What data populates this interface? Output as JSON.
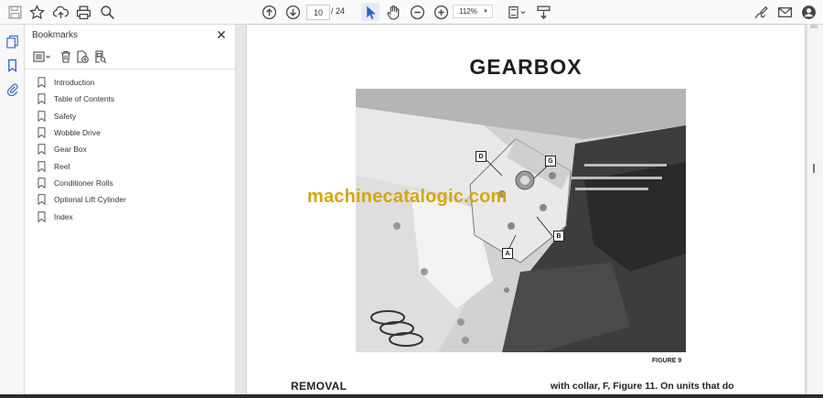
{
  "toolbar": {
    "page_current": "10",
    "page_separator": "/",
    "page_total": "24",
    "zoom": "112%",
    "icons": [
      "save-icon",
      "star-icon",
      "upload-cloud-icon",
      "print-icon",
      "zoom-search-icon",
      "prev-page-icon",
      "next-page-icon",
      "select-cursor-icon",
      "hand-icon",
      "zoom-out-icon",
      "zoom-in-icon",
      "fit-page-icon",
      "scroll-mode-icon",
      "sign-icon",
      "email-icon",
      "account-icon"
    ]
  },
  "rail": {
    "icons": [
      "pages-icon",
      "bookmark-icon",
      "attachment-icon"
    ]
  },
  "bookmarks": {
    "title": "Bookmarks",
    "items": [
      {
        "label": "Introduction"
      },
      {
        "label": "Table of Contents"
      },
      {
        "label": "Safety"
      },
      {
        "label": "Wobble Drive"
      },
      {
        "label": "Gear Box"
      },
      {
        "label": "Reel"
      },
      {
        "label": "Conditioner Rolls"
      },
      {
        "label": "Optional Lift Cylinder"
      },
      {
        "label": "Index"
      }
    ]
  },
  "document": {
    "title": "GEARBOX",
    "figure_caption": "FIGURE 9",
    "section_heading": "REMOVAL",
    "body_text": "with collar, F, Figure 11. On units that do",
    "watermark": "machinecatalogic.com",
    "photo_labels": [
      "D",
      "G",
      "B",
      "A"
    ]
  },
  "colors": {
    "watermark": "#d4a612",
    "active_tool": "#2a63c4",
    "icon": "#444444"
  }
}
